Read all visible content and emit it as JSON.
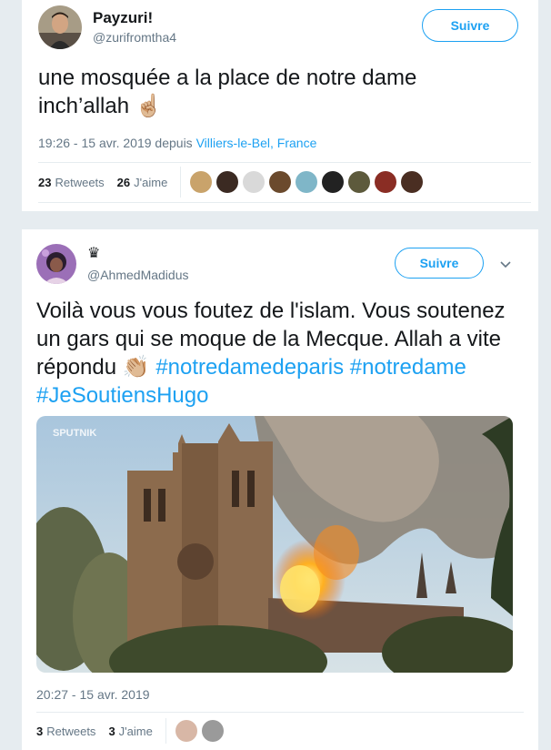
{
  "tweet1": {
    "display_name": "Payzuri!",
    "handle": "@zurifromtha4",
    "follow_label": "Suivre",
    "text": "une mosquée a la place de notre dame inch’allah",
    "emoji": "☝🏼",
    "timestamp": "19:26 - 15 avr. 2019 depuis",
    "location": "Villiers-le-Bel, France",
    "retweets_count": "23",
    "retweets_label": "Retweets",
    "likes_count": "26",
    "likes_label": "J'aime",
    "liker_colors": [
      "#c9a36b",
      "#3b2a22",
      "#d9d9d9",
      "#6b4a2d",
      "#7fb6c8",
      "#222222",
      "#5d5a3c",
      "#8a2d24",
      "#4a2e22"
    ]
  },
  "tweet2": {
    "display_name_icon": "♛",
    "handle": "@AhmedMadidus",
    "follow_label": "Suivre",
    "caret_icon": "chevron-down-icon",
    "text_plain": "Voilà vous vous foutez de l'islam. Vous soutenez un gars qui se moque de la Mecque. Allah a vite répondu",
    "emoji": "👏🏼",
    "hashtag1": "#notredamedeparis",
    "hashtag2": "#notredame",
    "hashtag3": "#JeSoutiensHugo",
    "photo_watermark": "SPUTNIK",
    "timestamp": "20:27 - 15 avr. 2019",
    "retweets_count": "3",
    "retweets_label": "Retweets",
    "likes_count": "3",
    "likes_label": "J'aime"
  }
}
